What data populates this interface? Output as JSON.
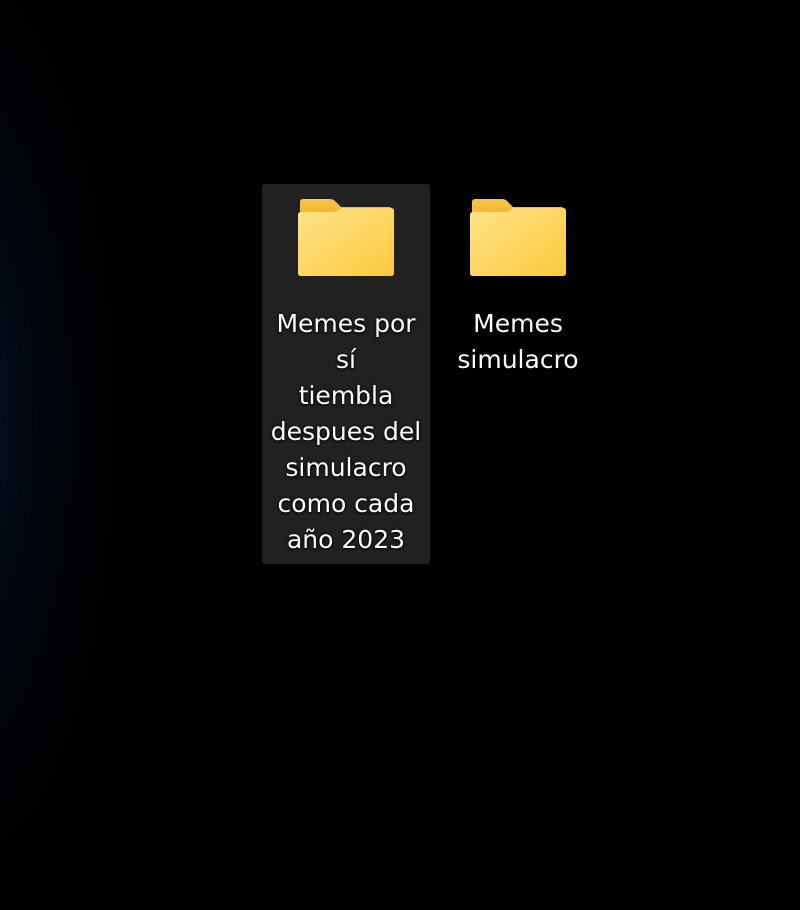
{
  "desktop": {
    "icons": [
      {
        "label_lines": [
          "Memes por sí",
          "tiembla",
          "despues del",
          "simulacro",
          "como cada",
          "año 2023"
        ],
        "icon": "folder-icon",
        "selected": true
      },
      {
        "label_lines": [
          "Memes",
          "simulacro"
        ],
        "icon": "folder-icon",
        "selected": false
      }
    ]
  },
  "colors": {
    "background": "#000000",
    "folder_back": "#F2B824",
    "folder_front": "#FFD75E",
    "selection": "#2b2b2b",
    "label_text": "#FFFFFF"
  }
}
